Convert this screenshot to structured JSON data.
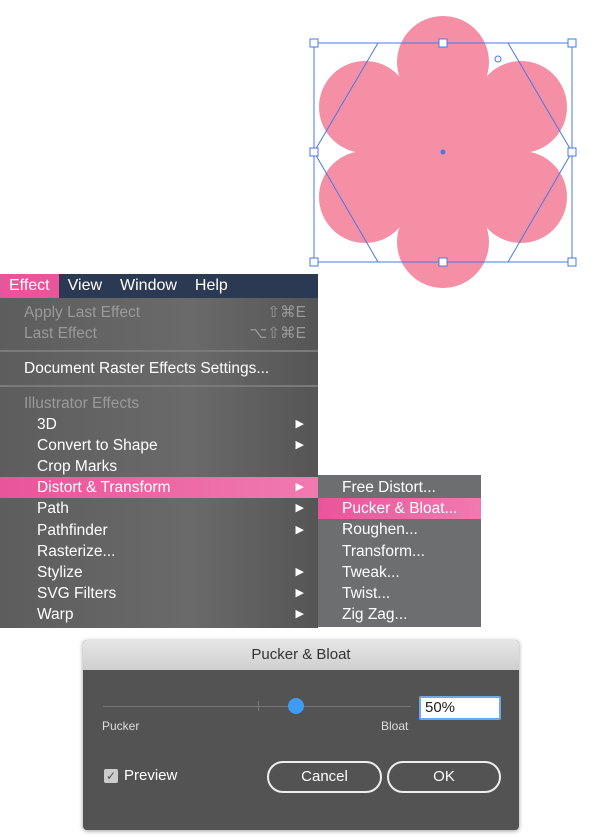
{
  "menubar": [
    "Effect",
    "View",
    "Window",
    "Help"
  ],
  "menu": {
    "apply_last": {
      "label": "Apply Last Effect",
      "shortcut": "⇧⌘E"
    },
    "last": {
      "label": "Last Effect",
      "shortcut": "⌥⇧⌘E"
    },
    "raster": "Document Raster Effects Settings...",
    "section": "Illustrator Effects",
    "items": [
      {
        "label": "3D",
        "sub": true
      },
      {
        "label": "Convert to Shape",
        "sub": true
      },
      {
        "label": "Crop Marks",
        "sub": false
      },
      {
        "label": "Distort & Transform",
        "sub": true,
        "selected": true
      },
      {
        "label": "Path",
        "sub": true
      },
      {
        "label": "Pathfinder",
        "sub": true
      },
      {
        "label": "Rasterize...",
        "sub": false
      },
      {
        "label": "Stylize",
        "sub": true
      },
      {
        "label": "SVG Filters",
        "sub": true
      },
      {
        "label": "Warp",
        "sub": true
      }
    ]
  },
  "submenu": [
    "Free Distort...",
    "Pucker & Bloat...",
    "Roughen...",
    "Transform...",
    "Tweak...",
    "Twist...",
    "Zig Zag..."
  ],
  "dialog": {
    "title": "Pucker & Bloat",
    "value": "50%",
    "slider_percent": 50,
    "min_label": "Pucker",
    "max_label": "Bloat",
    "preview_label": "Preview",
    "preview_checked": true,
    "cancel": "Cancel",
    "ok": "OK"
  },
  "colors": {
    "flower": "#f48fa6",
    "selection": "#4a78e0",
    "accent": "#e8559a",
    "slider": "#3d9bf0"
  }
}
